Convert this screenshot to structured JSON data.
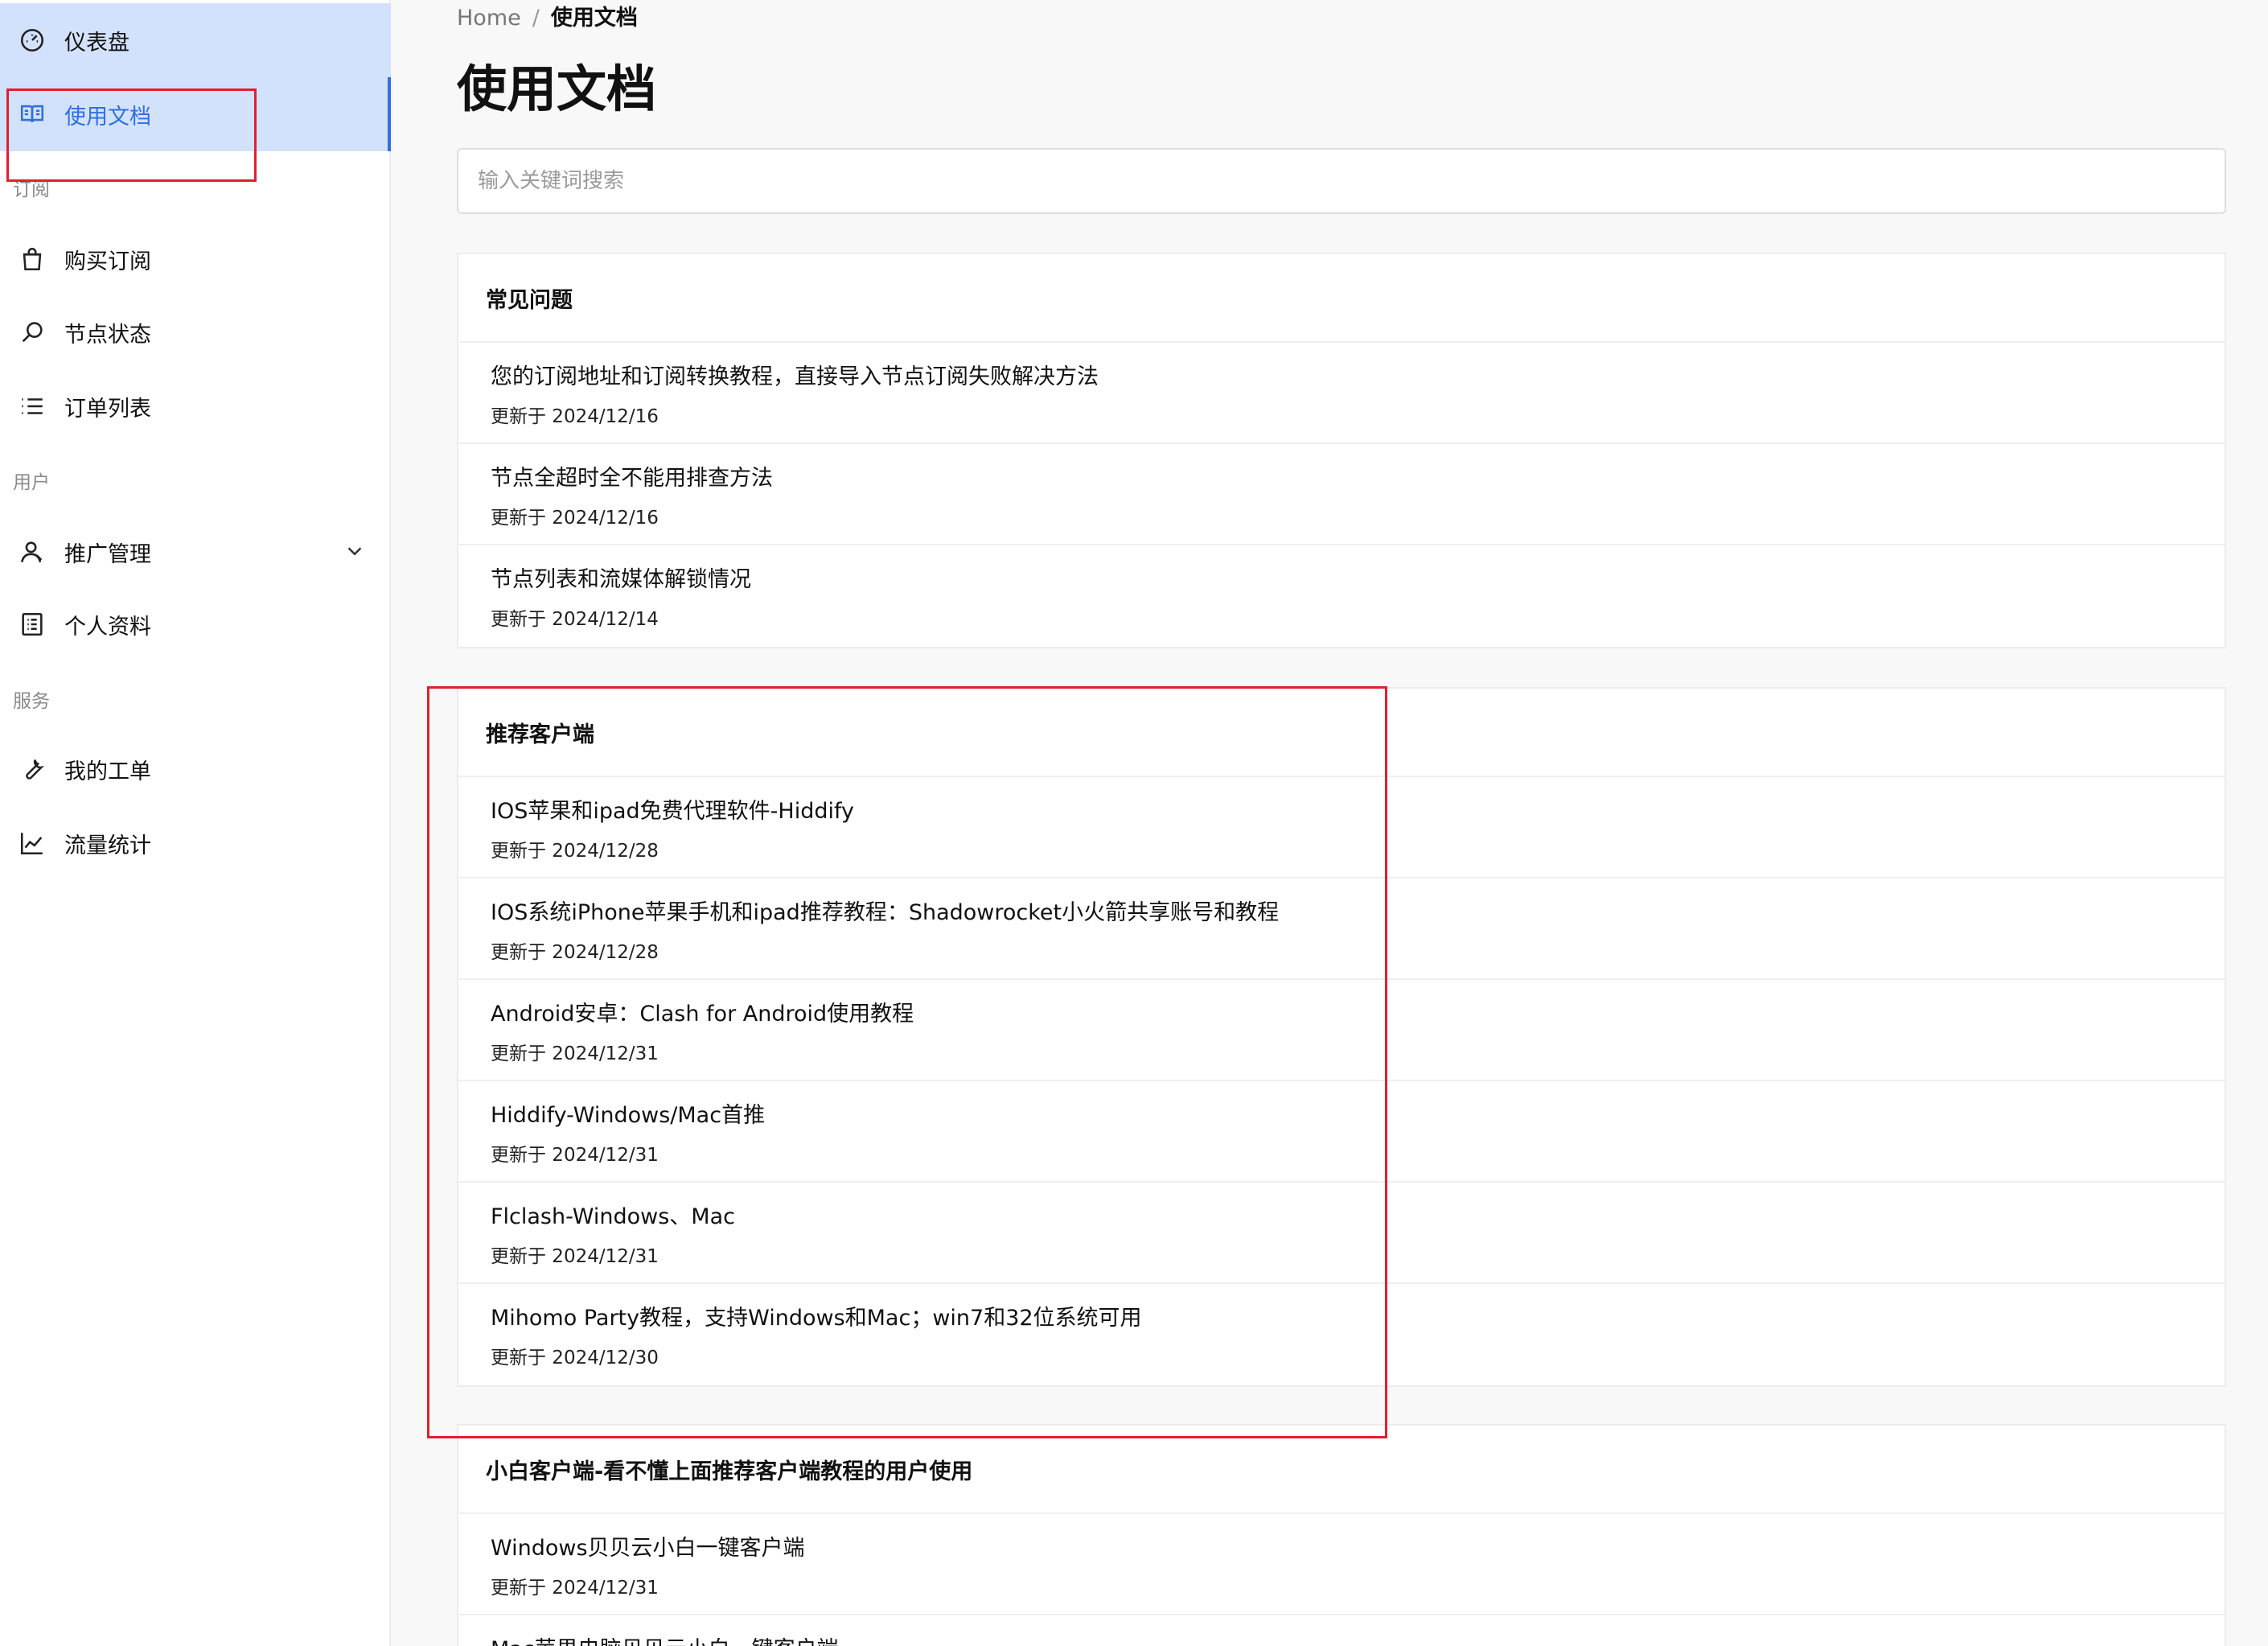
{
  "sidebar": {
    "items": [
      {
        "label": "仪表盘",
        "icon": "dashboard-icon"
      },
      {
        "label": "使用文档",
        "icon": "book-icon"
      },
      {
        "group": "订阅"
      },
      {
        "label": "购买订阅",
        "icon": "shopping-bag-icon"
      },
      {
        "label": "节点状态",
        "icon": "search-icon"
      },
      {
        "label": "订单列表",
        "icon": "list-icon"
      },
      {
        "group": "用户"
      },
      {
        "label": "推广管理",
        "icon": "user-icon"
      },
      {
        "label": "个人资料",
        "icon": "profile-icon"
      },
      {
        "group": "服务"
      },
      {
        "label": "我的工单",
        "icon": "wrench-icon"
      },
      {
        "label": "流量统计",
        "icon": "chart-icon"
      }
    ],
    "active_color": "#2f6fdf",
    "active_bg": "#d3e2fc"
  },
  "breadcrumb": {
    "home": "Home",
    "sep": "/",
    "current": "使用文档"
  },
  "page": {
    "title": "使用文档"
  },
  "search": {
    "placeholder": "输入关键词搜索"
  },
  "sections": [
    {
      "title": "常见问题",
      "items": [
        {
          "title": "您的订阅地址和订阅转换教程，直接导入节点订阅失败解决方法",
          "date": "更新于 2024/12/16"
        },
        {
          "title": "节点全超时全不能用排查方法",
          "date": "更新于 2024/12/16"
        },
        {
          "title": "节点列表和流媒体解锁情况",
          "date": "更新于 2024/12/14"
        }
      ]
    },
    {
      "title": "推荐客户端",
      "items": [
        {
          "title": "IOS苹果和ipad免费代理软件-Hiddify",
          "date": "更新于 2024/12/28"
        },
        {
          "title": "IOS系统iPhone苹果手机和ipad推荐教程：Shadowrocket小火箭共享账号和教程",
          "date": "更新于 2024/12/28"
        },
        {
          "title": "Android安卓：Clash for Android使用教程",
          "date": "更新于 2024/12/31"
        },
        {
          "title": "Hiddify-Windows/Mac首推",
          "date": "更新于 2024/12/31"
        },
        {
          "title": "Flclash-Windows、Mac",
          "date": "更新于 2024/12/31"
        },
        {
          "title": "Mihomo Party教程，支持Windows和Mac；win7和32位系统可用",
          "date": "更新于 2024/12/30"
        }
      ]
    },
    {
      "title": "小白客户端-看不懂上面推荐客户端教程的用户使用",
      "items": [
        {
          "title": "Windows贝贝云小白一键客户端",
          "date": "更新于 2024/12/31"
        },
        {
          "title": "Mac苹果电脑贝贝云小白一键客户端",
          "date": ""
        }
      ]
    }
  ],
  "highlight_color": "#e0202e"
}
